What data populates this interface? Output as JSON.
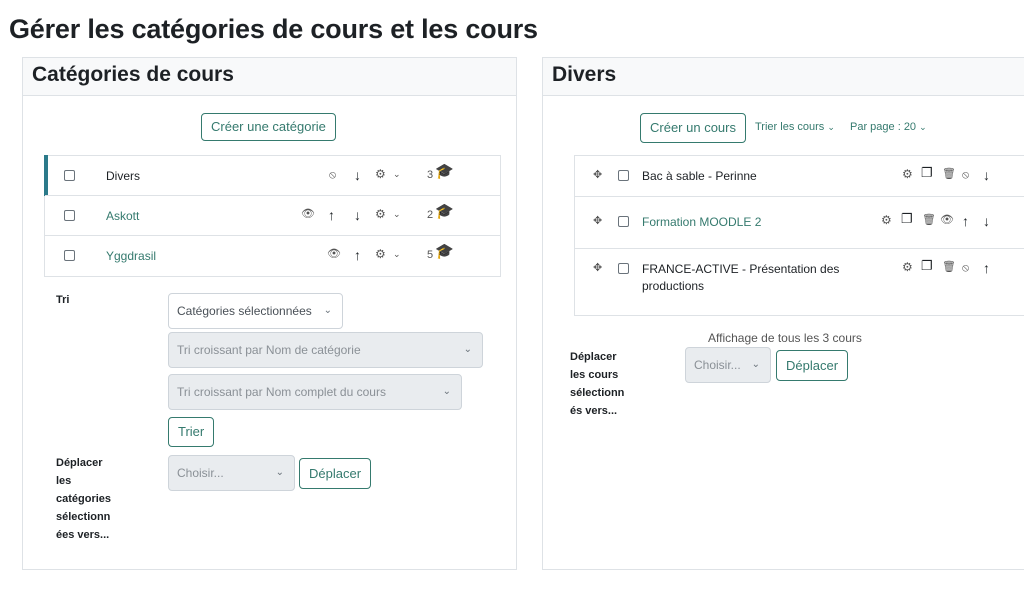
{
  "page": {
    "title": "Gérer les catégories de cours et les cours"
  },
  "left": {
    "title": "Catégories de cours",
    "create_button": "Créer une catégorie",
    "categories": [
      {
        "name": "Divers",
        "count": "3"
      },
      {
        "name": "Askott",
        "count": "2"
      },
      {
        "name": "Yggdrasil",
        "count": "5"
      }
    ],
    "sort": {
      "label": "Tri",
      "select_selected": "Catégories sélectionnées",
      "select_cat_name": "Tri croissant par Nom de catégorie",
      "select_course_name": "Tri croissant par Nom complet du cours",
      "sort_button": "Trier"
    },
    "move": {
      "label_lines": [
        "Déplacer",
        "les",
        "catégories",
        "sélectionn",
        "ées vers..."
      ],
      "select_placeholder": "Choisir...",
      "move_button": "Déplacer"
    }
  },
  "right": {
    "title": "Divers",
    "create_button": "Créer un cours",
    "sort_label": "Trier les cours",
    "per_page": "Par page : 20",
    "courses": [
      {
        "name_lines": [
          "Bac à sable - Perinne"
        ]
      },
      {
        "name_lines": [
          "Formation MOODLE 2"
        ]
      },
      {
        "name_lines": [
          "FRANCE-ACTIVE - Présentation des",
          "productions"
        ]
      }
    ],
    "showing": "Affichage de tous les 3 cours",
    "move": {
      "label_lines": [
        "Déplacer",
        "les cours",
        "sélectionn",
        "és vers..."
      ],
      "select_placeholder": "Choisir...",
      "move_button": "Déplacer"
    }
  },
  "colors": {
    "accent": "#357a6e",
    "border": "#dee2e6"
  }
}
